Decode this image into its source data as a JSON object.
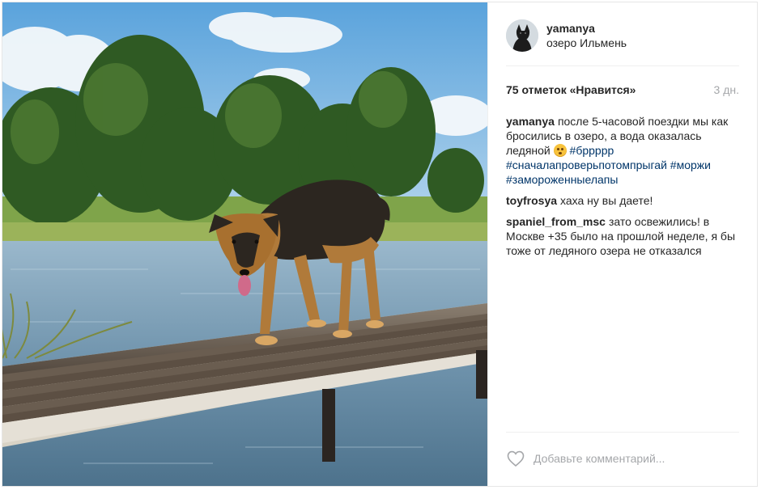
{
  "post": {
    "username": "yamanya",
    "location": "озеро Ильмень",
    "likes_text": "75 отметок «Нравится»",
    "time_ago": "3 дн.",
    "caption": {
      "user": "yamanya",
      "text": "после 5-часовой поездки мы как бросились в озеро, а вода оказалась ледяной",
      "emoji": "flushed-face-emoji",
      "tags": [
        "#бррррр",
        "#сначалапроверьпотомпрыгай",
        "#моржи",
        "#замороженныелапы"
      ]
    },
    "comments": [
      {
        "user": "toyfrosya",
        "text": "хаха ну вы даете!"
      },
      {
        "user": "spaniel_from_msc",
        "text": "зато освежились! в Москве +35 было на прошлой неделе, я бы тоже от ледяного озера не отказался"
      }
    ],
    "add_comment_placeholder": "Добавьте комментарий..."
  },
  "icons": {
    "like": "heart-outline-icon"
  },
  "colors": {
    "hashtag": "#003569",
    "muted": "#a5a7aa",
    "text": "#262626",
    "border": "#efefef"
  }
}
